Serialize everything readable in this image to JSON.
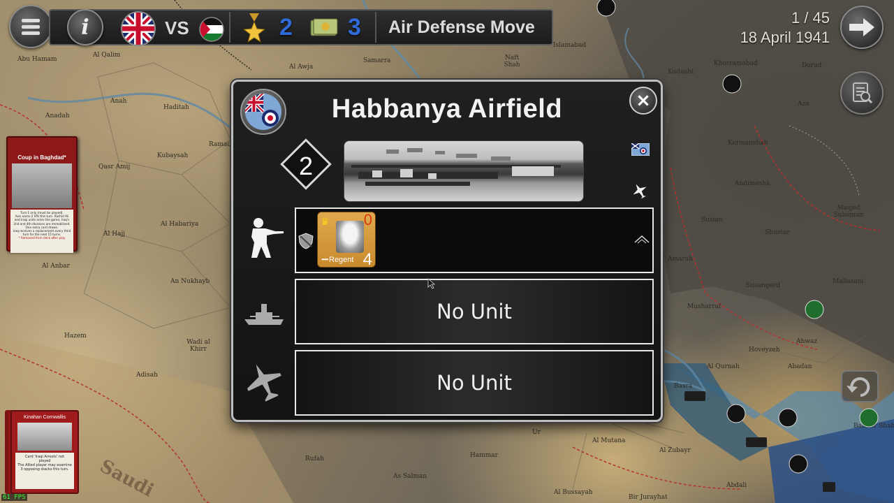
{
  "topbar": {
    "menu_icon": "hamburger-menu-icon",
    "info_icon": "info-icon",
    "info_label": "i",
    "player_flag": "union-jack-flag-icon",
    "vs_label": "VS",
    "opponent_flag": "iraq-flag-icon",
    "vp_icon": "medal-star-icon",
    "victory_points": "2",
    "money_icon": "money-stack-icon",
    "resources": "3",
    "phase": "Air Defense Move"
  },
  "turn": {
    "counter": "1 / 45",
    "date": "18 April 1941"
  },
  "right_buttons": {
    "next_turn_icon": "arrow-right-icon",
    "log_icon": "report-magnifier-icon"
  },
  "event_card": {
    "title": "Coup in Baghdad*",
    "lines": [
      "Turn 1 only (must be played).",
      "Axis earns 2 VPs this turn. Rashid Ali",
      "and Iraqi units enter the game; Iraq's",
      "2nd and 4th divisions are immobilised.",
      "One extra card drawn.",
      "Iraq receives a replacement every third",
      "turn for the next 15 turns."
    ],
    "note": "* Removed from deck after play"
  },
  "leader_card": {
    "title": "Kinahan Cornwallis",
    "lines": [
      "Card 'Iraqi Arrests' not",
      "played",
      "The Allied player may examine",
      "3 opposing stacks this turn."
    ]
  },
  "fps": "61 FPS",
  "map_labels": {
    "sea_text": "Saudi",
    "places": [
      "Al Qalim",
      "Abu Hamam",
      "Anah",
      "Haditah",
      "Anadah",
      "Kubaysah",
      "Ramad",
      "Qasr Amij",
      "Al Habariya",
      "Al Hajj",
      "Al Anbar",
      "An Nukhayb",
      "Hazem",
      "Wadi al Khirr",
      "Adisah",
      "Al Awja",
      "Samarra",
      "Naft Shah",
      "Islamabad",
      "Kudasht",
      "Khorramabad",
      "Dorud",
      "Aza",
      "Kermanshah",
      "Andimeshk",
      "Susian",
      "Shustar",
      "Masjed Suleiman",
      "Amarah",
      "Musharraf",
      "Susangerd",
      "Mallasani",
      "Al Qurnah",
      "Hoveyzeh",
      "Abadan",
      "Ahwaz",
      "Basra",
      "Al Zubayr",
      "Al Mutana",
      "Hammar",
      "Ur",
      "Rufah",
      "As Salman",
      "Al Bussayah",
      "Bir Jurayhat",
      "Abdali",
      "Bandar Shahpur"
    ]
  },
  "dialog": {
    "title": "Habbanya Airfield",
    "owner_icon": "raf-roundel-icon",
    "close_icon": "close-icon",
    "close_label": "×",
    "victory_value": "2",
    "photo_icon": "airfield-photo",
    "side_flag_icon": "raf-ensign-flag-icon",
    "side_plane_icon": "airplane-icon",
    "land": {
      "category_icon": "infantry-soldier-icon",
      "shield_icon": "shield-icon",
      "terrain_icon": "terrain-hill-icon",
      "unit": {
        "name": "Regent",
        "attack": "0",
        "defense": "4",
        "minus": "−",
        "crown_icon": "crown-icon",
        "portrait": "regent-portrait"
      }
    },
    "naval": {
      "category_icon": "battleship-icon",
      "text": "No Unit"
    },
    "air": {
      "category_icon": "fighter-plane-icon",
      "text": "No Unit"
    }
  },
  "colors": {
    "score_blue": "#2f6ad8",
    "attack_red": "#d33b10",
    "card_red": "#8c1818",
    "fps_green": "#35ff35"
  }
}
